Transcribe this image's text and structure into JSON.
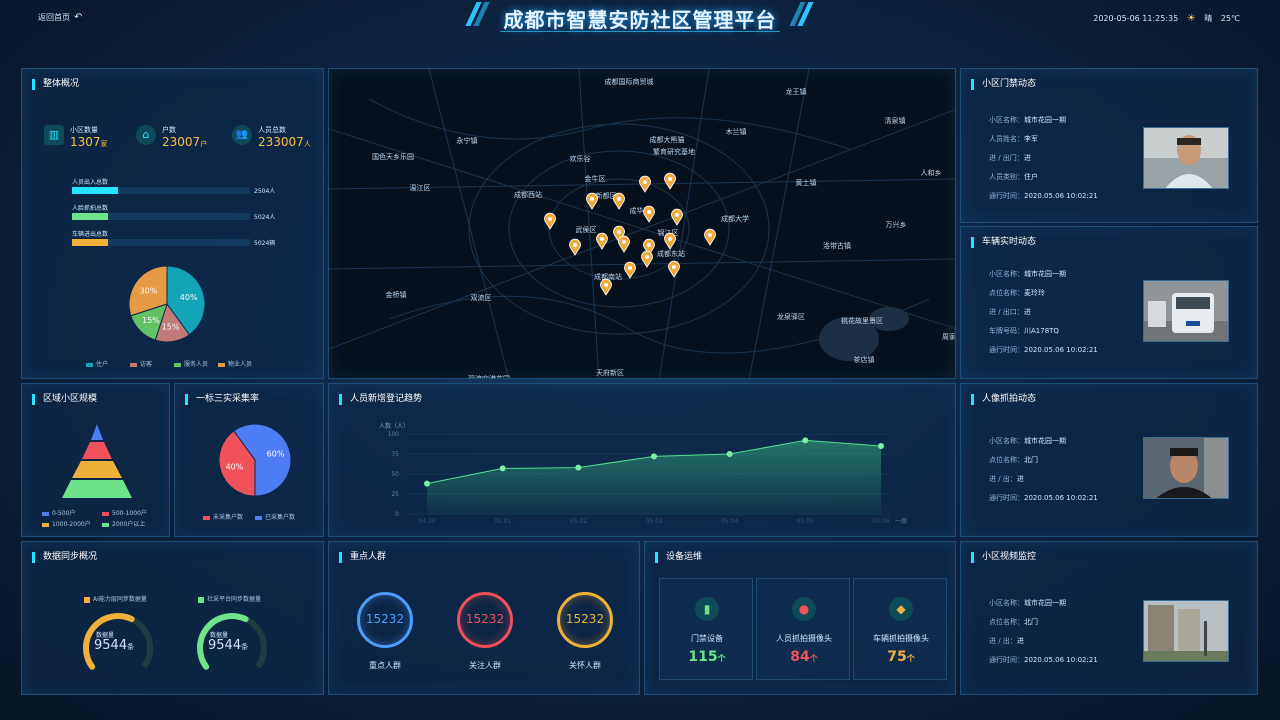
{
  "header": {
    "back_label": "返回首页",
    "title": "成都市智慧安防社区管理平台",
    "datetime": "2020-05-06 11:25:35",
    "weather": "晴",
    "temperature": "25℃"
  },
  "overview": {
    "title": "整体概况",
    "stats": [
      {
        "label": "小区数量",
        "value": "1307",
        "unit": "家"
      },
      {
        "label": "户数",
        "value": "23007",
        "unit": "户"
      },
      {
        "label": "人员总数",
        "value": "233007",
        "unit": "人"
      }
    ],
    "bars": [
      {
        "label": "人员出入总数",
        "value": "2504人",
        "fraction": 0.26,
        "color": "#26e4ff"
      },
      {
        "label": "人脸抓拍总数",
        "value": "5024人",
        "fraction": 0.2,
        "color": "#6ee38a"
      },
      {
        "label": "车辆进出总数",
        "value": "5024辆",
        "fraction": 0.2,
        "color": "#f0b13a"
      }
    ],
    "pie": {
      "slices": [
        {
          "name": "住户",
          "percent": 40,
          "color": "#13a4b8"
        },
        {
          "name": "访客",
          "percent": 15,
          "color": "#c07a78"
        },
        {
          "name": "服务人员",
          "percent": 15,
          "color": "#63c266"
        },
        {
          "name": "物业人员",
          "percent": 30,
          "color": "#e79a46"
        }
      ],
      "labels": [
        "40%",
        "15%",
        "15%",
        "30%"
      ]
    }
  },
  "map": {
    "places": [
      "成都国际商贸城",
      "龙王镇",
      "永宁镇",
      "成都大熊猫",
      "繁育研究基地",
      "木兰镇",
      "国色天乡乐园",
      "欢乐谷",
      "清泉镇",
      "金牛区",
      "温江区",
      "成都西站",
      "新都区",
      "成华区",
      "黄土镇",
      "人和乡",
      "成都大学",
      "武侯区",
      "锦江区",
      "万兴乡",
      "洛带古镇",
      "成都东站",
      "成都南站",
      "金桥镇",
      "双流区",
      "龙泉驿区",
      "桃花故里景区",
      "茶店镇",
      "周家",
      "天府新区",
      "双流空港花园"
    ]
  },
  "gate": {
    "title": "小区门禁动态",
    "rows": [
      {
        "k": "小区名称：",
        "v": "城市花园一期"
      },
      {
        "k": "人员姓名：",
        "v": "李军"
      },
      {
        "k": "进 / 出门：",
        "v": "进"
      },
      {
        "k": "人员类别：",
        "v": "住户"
      },
      {
        "k": "通行时间：",
        "v": "2020.05.06 10:02:21"
      }
    ]
  },
  "vehicle": {
    "title": "车辆实时动态",
    "rows": [
      {
        "k": "小区名称：",
        "v": "城市花园一期"
      },
      {
        "k": "点位名称：",
        "v": "麦玲玲"
      },
      {
        "k": "进 / 出口：",
        "v": "进"
      },
      {
        "k": "车牌号码：",
        "v": "川A178TQ"
      },
      {
        "k": "通行时间：",
        "v": "2020.05.06 10:02:21"
      }
    ]
  },
  "face": {
    "title": "人像抓拍动态",
    "rows": [
      {
        "k": "小区名称：",
        "v": "城市花园一期"
      },
      {
        "k": "点位名称：",
        "v": "北门"
      },
      {
        "k": "进 / 出：",
        "v": "进"
      },
      {
        "k": "通行时间：",
        "v": "2020.05.06 10:02:21"
      }
    ]
  },
  "video": {
    "title": "小区视频监控",
    "rows": [
      {
        "k": "小区名称：",
        "v": "城市花园一期"
      },
      {
        "k": "点位名称：",
        "v": "北门"
      },
      {
        "k": "进 / 出：",
        "v": "进"
      },
      {
        "k": "通行时间：",
        "v": "2020.05.06 10:02:21"
      }
    ]
  },
  "scale": {
    "title": "区域小区规模",
    "legend": [
      {
        "label": "0-500户",
        "color": "#4d7cf5"
      },
      {
        "label": "500-1000户",
        "color": "#f0515a"
      },
      {
        "label": "1000-2000户",
        "color": "#f0b13a"
      },
      {
        "label": "2000户以上",
        "color": "#6ee38a"
      }
    ]
  },
  "collect": {
    "title": "一标三实采集率",
    "slices": [
      {
        "name": "未采集户数",
        "percent": 40,
        "label": "40%",
        "color": "#f0515a"
      },
      {
        "name": "已采集户数",
        "percent": 60,
        "label": "60%",
        "color": "#4d7cf5"
      }
    ]
  },
  "trend": {
    "title": "人员新增登记趋势",
    "chart_data": {
      "type": "area",
      "ylabel": "人数（人）",
      "xlabel": "一周",
      "yticks": [
        "100",
        "75",
        "50",
        "25",
        "0"
      ],
      "ylim": [
        0,
        100
      ],
      "categories": [
        "04.30",
        "05.01",
        "05.02",
        "05.03",
        "05.04",
        "05.05",
        "05.06"
      ],
      "values": [
        38,
        57,
        58,
        72,
        75,
        92,
        85
      ]
    }
  },
  "sync": {
    "title": "数据同步概况",
    "gauges": [
      {
        "legend": "AI能力层同步数据量",
        "label": "数据量",
        "value": "9544",
        "unit": "条",
        "color": "#f0b13a",
        "fraction": 0.6
      },
      {
        "legend": "社采平台同步数据量",
        "label": "数据量",
        "value": "9544",
        "unit": "条",
        "color": "#6ee38a",
        "fraction": 0.6
      }
    ]
  },
  "key": {
    "title": "重点人群",
    "rings": [
      {
        "value": "15232",
        "label": "重点人群",
        "color": "#4d9cff"
      },
      {
        "value": "15232",
        "label": "关注人群",
        "color": "#f0515a"
      },
      {
        "value": "15232",
        "label": "关怀人群",
        "color": "#f0b13a"
      }
    ]
  },
  "device": {
    "title": "设备运维",
    "cards": [
      {
        "label": "门禁设备",
        "value": "115",
        "unit": "个",
        "color": "#6ee38a",
        "icon": "door-icon"
      },
      {
        "label": "人员抓拍摄像头",
        "value": "84",
        "unit": "个",
        "color": "#f0515a",
        "icon": "person-camera-icon"
      },
      {
        "label": "车辆抓拍摄像头",
        "value": "75",
        "unit": "个",
        "color": "#f0b13a",
        "icon": "car-camera-icon"
      }
    ]
  }
}
